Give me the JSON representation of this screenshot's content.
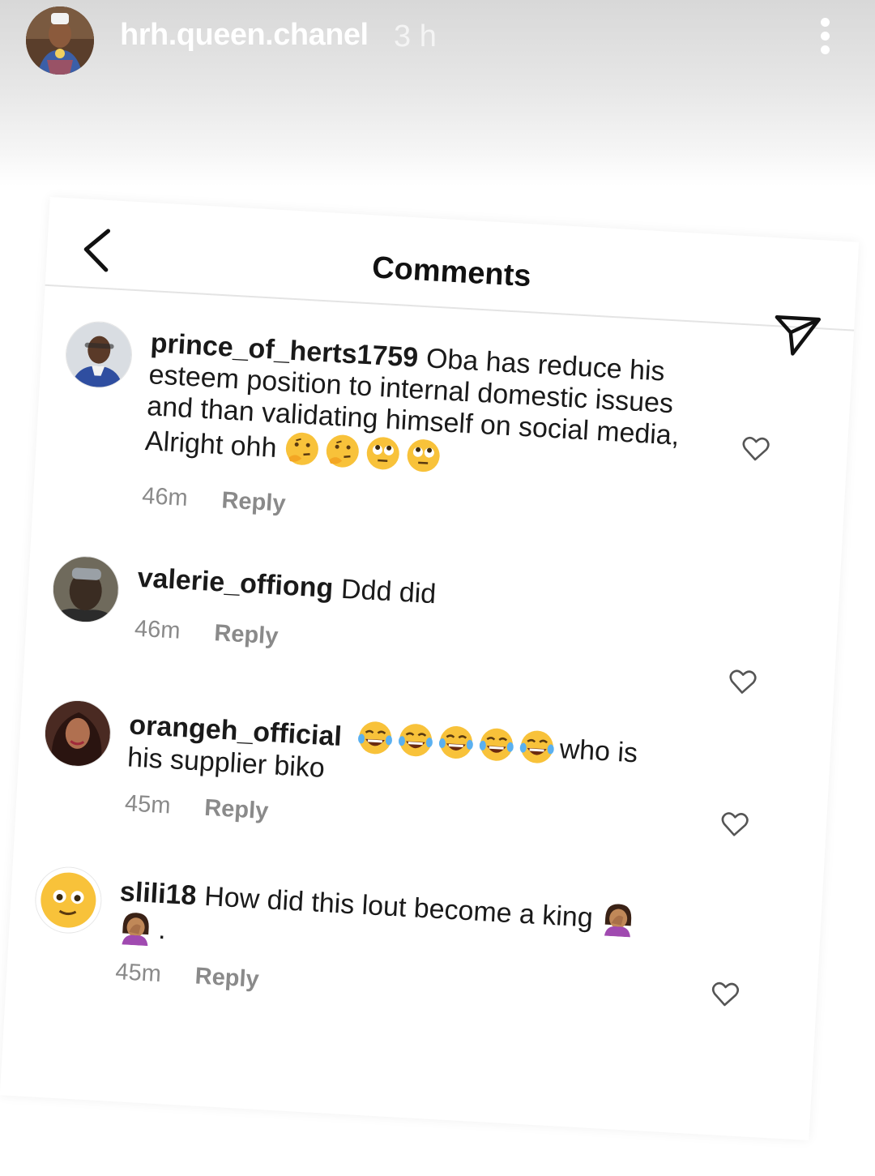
{
  "story": {
    "username": "hrh.queen.chanel",
    "time": "3 h"
  },
  "screen": {
    "title": "Comments"
  },
  "comments": [
    {
      "username": "prince_of_herts1759",
      "text": "Oba has reduce his esteem position to internal domestic issues and than validating himself on social media, Alright ohh",
      "emojis": [
        "thinking-face",
        "thinking-face",
        "eye-roll-face",
        "eye-roll-face"
      ],
      "time": "46m",
      "reply": "Reply"
    },
    {
      "username": "valerie_offiong",
      "text": "Ddd did",
      "time": "46m",
      "reply": "Reply"
    },
    {
      "username": "orangeh_official",
      "text_after_emojis": "who is his supplier biko",
      "emojis": [
        "tears-of-joy",
        "tears-of-joy",
        "tears-of-joy",
        "tears-of-joy",
        "tears-of-joy"
      ],
      "time": "45m",
      "reply": "Reply"
    },
    {
      "username": "slili18",
      "text": "How did this lout become a king",
      "emojis": [
        "face-palm",
        "face-palm"
      ],
      "trailing": ".",
      "time": "45m",
      "reply": "Reply"
    }
  ],
  "colors": {
    "header_gradient_top": "#d8d8d8",
    "username_color": "#ffffff",
    "meta_gray": "#8a8a8a"
  }
}
